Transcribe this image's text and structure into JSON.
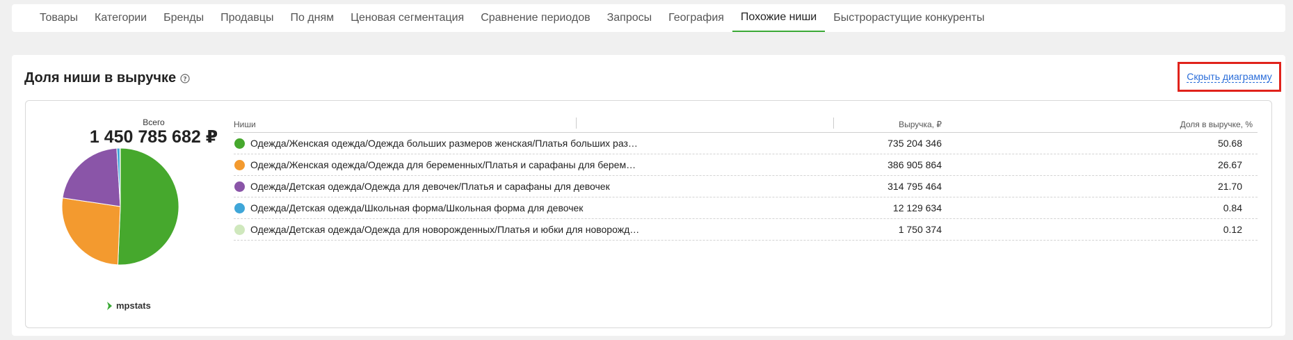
{
  "tabs": [
    {
      "label": "Товары",
      "active": false
    },
    {
      "label": "Категории",
      "active": false
    },
    {
      "label": "Бренды",
      "active": false
    },
    {
      "label": "Продавцы",
      "active": false
    },
    {
      "label": "По дням",
      "active": false
    },
    {
      "label": "Ценовая сегментация",
      "active": false
    },
    {
      "label": "Сравнение периодов",
      "active": false
    },
    {
      "label": "Запросы",
      "active": false
    },
    {
      "label": "География",
      "active": false
    },
    {
      "label": "Похожие ниши",
      "active": true
    },
    {
      "label": "Быстрорастущие конкуренты",
      "active": false
    }
  ],
  "section": {
    "title": "Доля ниши в выручке",
    "help_icon": "question-circle-icon",
    "hide_chart_label": "Скрыть диаграмму"
  },
  "summary": {
    "total_label": "Всего",
    "total_value": "1 450 785 682 ₽",
    "brand": "mpstats",
    "brand_icon": "mpstats-logo-icon",
    "brand_color": "#3aa935"
  },
  "table": {
    "headers": {
      "niche": "Ниши",
      "revenue": "Выручка, ₽",
      "share": "Доля в выручке, %"
    },
    "rows": [
      {
        "niche": "Одежда/Женская одежда/Одежда больших размеров женская/Платья больших размеров",
        "revenue": "735 204 346",
        "share": "50.68",
        "color": "#46a82d"
      },
      {
        "niche": "Одежда/Женская одежда/Одежда для беременных/Платья и сарафаны для беременных",
        "revenue": "386 905 864",
        "share": "26.67",
        "color": "#f39a2f"
      },
      {
        "niche": "Одежда/Детская одежда/Одежда для девочек/Платья и сарафаны для девочек",
        "revenue": "314 795 464",
        "share": "21.70",
        "color": "#8a55a8"
      },
      {
        "niche": "Одежда/Детская одежда/Школьная форма/Школьная форма для девочек",
        "revenue": "12 129 634",
        "share": "0.84",
        "color": "#3fa6d8"
      },
      {
        "niche": "Одежда/Детская одежда/Одежда для новорожденных/Платья и юбки для новорожденных",
        "revenue": "1 750 374",
        "share": "0.12",
        "color": "#cfe8bd"
      }
    ]
  },
  "chart_data": {
    "type": "pie",
    "values": [
      50.68,
      26.67,
      21.7,
      0.84,
      0.12
    ],
    "colors": [
      "#46a82d",
      "#f39a2f",
      "#8a55a8",
      "#3fa6d8",
      "#cfe8bd"
    ]
  }
}
